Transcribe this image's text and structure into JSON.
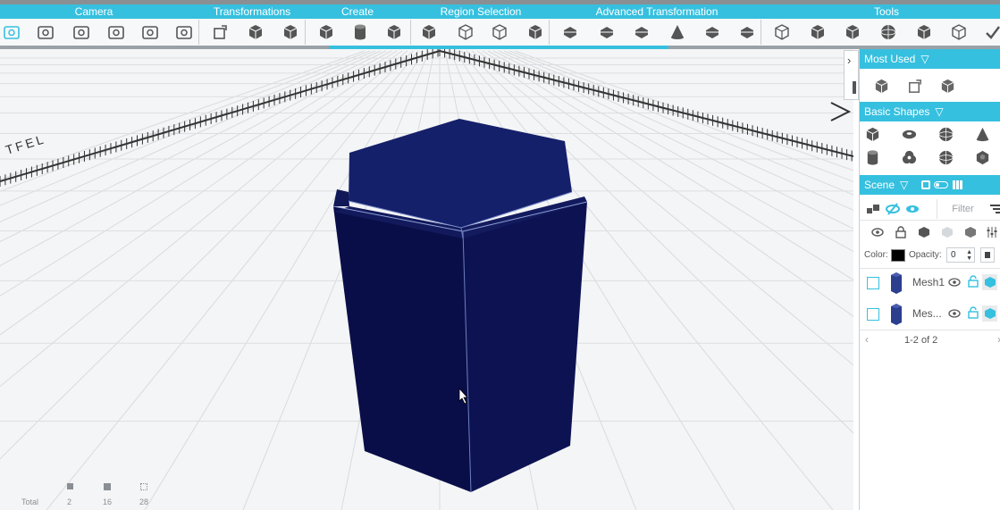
{
  "toolbar": {
    "categories": [
      {
        "label": "Camera"
      },
      {
        "label": "Transformations"
      },
      {
        "label": "Create"
      },
      {
        "label": "Region Selection"
      },
      {
        "label": "Advanced Transformation"
      },
      {
        "label": "Tools"
      }
    ],
    "camera_tools": [
      "home-view-icon",
      "select-view-icon",
      "focus-view-icon",
      "rotate-view-icon",
      "camera-snapshot-icon",
      "camera-lock-icon"
    ],
    "transformation_tools": [
      "transform-icon",
      "move-cube-icon",
      "scale-cube-icon"
    ],
    "create_tools": [
      "create-box-icon",
      "create-cylinder-icon",
      "create-shape-icon"
    ],
    "region_tools": [
      "region-select-icon",
      "region-box-icon",
      "region-plane-icon",
      "region-split-icon"
    ],
    "advanced_tools": [
      "extrude-icon",
      "subdivide-icon",
      "bend-icon",
      "taper-icon",
      "twist-icon",
      "slice-icon"
    ],
    "tools": [
      "wireframe-box-icon",
      "solid-box-icon",
      "cube-tool-icon",
      "sphere-tool-icon",
      "mesh-tool-icon",
      "cube-outline-icon",
      "check-tool-icon"
    ],
    "progress_fraction": 0.67
  },
  "viewport": {
    "ruler_label": "LEFT",
    "stats": {
      "total_label": "Total",
      "meshes": "2",
      "faces": "16",
      "vertices": "28"
    }
  },
  "panel": {
    "most_used": {
      "title": "Most Used",
      "icons": [
        "cube-icon",
        "transform-icon",
        "mesh-edit-icon"
      ]
    },
    "basic_shapes": {
      "title": "Basic Shapes",
      "icons": [
        "cube-icon",
        "torus-icon",
        "sphere-icon",
        "cone-icon",
        "cylinder-icon",
        "knot-icon",
        "geosphere-icon",
        "dodecahedron-icon"
      ]
    },
    "scene": {
      "title": "Scene",
      "filter_placeholder": "Filter",
      "color_label": "Color:",
      "color_value": "#000000",
      "opacity_label": "Opacity:",
      "opacity_value": "0",
      "items": [
        {
          "name": "Mesh1"
        },
        {
          "name": "Mes..."
        }
      ],
      "pager": "1-2 of 2"
    }
  },
  "colors": {
    "accent": "#36c0df",
    "mesh": "#0b0f4a"
  }
}
